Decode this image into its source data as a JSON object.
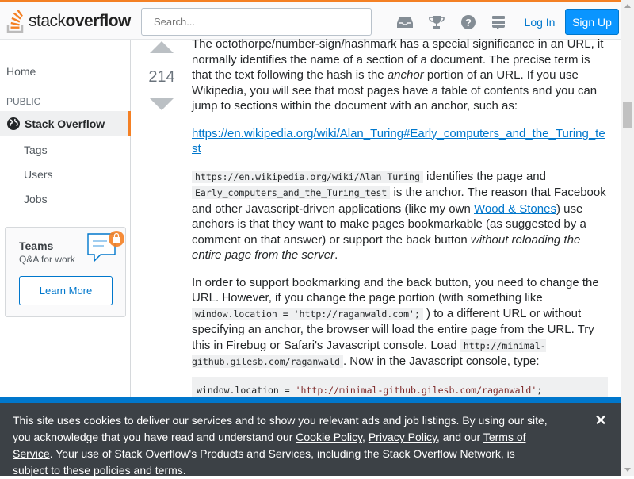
{
  "header": {
    "logo_light": "stack",
    "logo_bold": "overflow",
    "search_placeholder": "Search...",
    "inbox_icon": "inbox-icon",
    "achievements_icon": "trophy-icon",
    "help_icon": "help-icon",
    "sites_icon": "stack-exchange-icon",
    "login_label": "Log In",
    "signup_label": "Sign Up",
    "accent_color": "#f48024",
    "brand_blue": "#0a95ff"
  },
  "sidebar": {
    "home": "Home",
    "public_heading": "PUBLIC",
    "stack_overflow": "Stack Overflow",
    "tags": "Tags",
    "users": "Users",
    "jobs": "Jobs",
    "teams_title": "Teams",
    "teams_sub": "Q&A for work",
    "learn_more": "Learn More"
  },
  "vote": {
    "score": "214"
  },
  "answer": {
    "p1_a": "The octothorpe/number-sign/hashmark has a special significance in an URL, it normally identifies the name of a section of a document. The precise term is that the text following the hash is the ",
    "p1_em": "anchor",
    "p1_b": " portion of an URL. If you use Wikipedia, you will see that most pages have a table of contents and you can jump to sections within the document with an anchor, such as:",
    "link1": "https://en.wikipedia.org/wiki/Alan_Turing#Early_computers_and_the_Turing_test",
    "p3_code1": "https://en.wikipedia.org/wiki/Alan_Turing",
    "p3_a": " identifies the page and ",
    "p3_code2": "Early_computers_and_the_Turing_test",
    "p3_b": " is the anchor. The reason that Facebook and other Javascript-driven applications (like my own ",
    "p3_link": "Wood & Stones",
    "p3_c": ") use anchors is that they want to make pages bookmarkable (as suggested by a comment on that answer) or support the back button ",
    "p3_em": "without reloading the entire page from the server",
    "p3_d": ".",
    "p4_a": "In order to support bookmarking and the back button, you need to change the URL. However, if you change the page portion (with something like ",
    "p4_code1": "window.location = 'http://raganwald.com';",
    "p4_b": " ) to a different URL or without specifying an anchor, the browser will load the entire page from the URL. Try this in Firebug or Safari's Javascript console. Load ",
    "p4_code2": "http://minimal-github.gilesb.com/raganwald",
    "p4_c": ". Now in the Javascript console, type:",
    "pre_a": "window.location = ",
    "pre_str": "'http://minimal-github.gilesb.com/raganwald'",
    "pre_b": ";"
  },
  "cookie": {
    "t1": "This site uses cookies to deliver our services and to show you relevant ads and job listings. By using our site, you acknowledge that you have read and understand our ",
    "cookie_policy": "Cookie Policy",
    "sep1": ", ",
    "privacy_policy": "Privacy Policy",
    "t2": ", and our ",
    "terms": "Terms of Service",
    "t3": ". Your use of Stack Overflow's Products and Services, including the Stack Overflow Network, is subject to these policies and terms.",
    "close_label": "✕"
  }
}
